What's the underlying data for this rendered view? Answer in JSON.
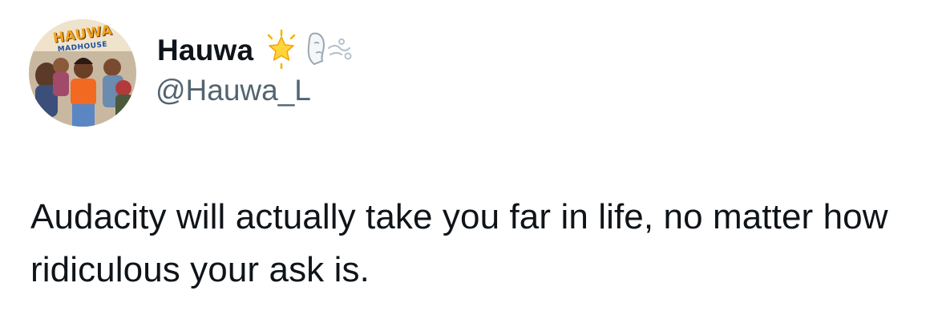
{
  "author": {
    "display_name": "Hauwa",
    "handle": "@Hauwa_L",
    "avatar_title": "HAUWA",
    "avatar_subtitle": "MADHOUSE",
    "badges": [
      "glowing-star-emoji",
      "face-exhaling-emoji"
    ]
  },
  "tweet": {
    "text": "Audacity will actually take you far in life, no matter how ridiculous your ask is."
  },
  "colors": {
    "text_primary": "#0f1419",
    "text_secondary": "#536471",
    "background": "#ffffff"
  }
}
